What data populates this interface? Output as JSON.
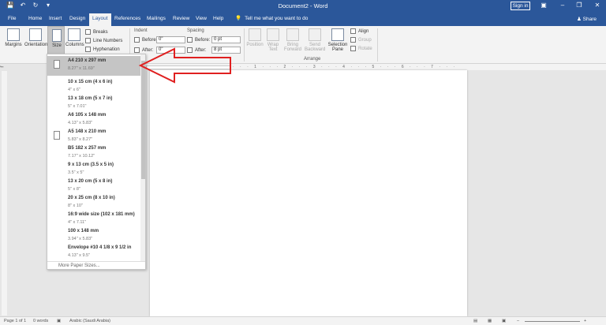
{
  "titlebar": {
    "title": "Document2  -  Word",
    "signin": "Sign in",
    "qat": [
      "save-icon",
      "undo-icon",
      "redo-icon",
      "customize-icon"
    ]
  },
  "tabs": [
    "File",
    "Home",
    "Insert",
    "Design",
    "Layout",
    "References",
    "Mailings",
    "Review",
    "View",
    "Help"
  ],
  "active_tab": "Layout",
  "tellme": "Tell me what you want to do",
  "share": "Share",
  "ribbon": {
    "margins": "Margins",
    "orientation": "Orientation",
    "size": "Size",
    "columns": "Columns",
    "breaks": "Breaks",
    "line_numbers": "Line Numbers",
    "hyphenation": "Hyphenation",
    "indent_label": "Indent",
    "indent_before_label": "Before:",
    "indent_before_value": "0\"",
    "indent_after_label": "After:",
    "indent_after_value": "0\"",
    "spacing_label": "Spacing",
    "spacing_before_label": "Before:",
    "spacing_before_value": "0 pt",
    "spacing_after_label": "After:",
    "spacing_after_value": "8 pt",
    "position": "Position",
    "wrap_text": "Wrap Text",
    "bring_forward": "Bring Forward",
    "send_backward": "Send Backward",
    "selection_pane": "Selection Pane",
    "align": "Align",
    "group": "Group",
    "rotate": "Rotate",
    "arrange_label": "Arrange"
  },
  "paper_sizes": [
    {
      "name": "A4 210 x 297 mm",
      "dims": "8.27\" x 11.69\"",
      "selected": true
    },
    {
      "name": "10 x 15 cm (4 x 6 in)",
      "dims": "4\" x 6\""
    },
    {
      "name": "13 x 18 cm (5 x 7 in)",
      "dims": "5\" x 7.01\""
    },
    {
      "name": "A6 105 x 148 mm",
      "dims": "4.13\" x 5.83\""
    },
    {
      "name": "A5 148 x 210 mm",
      "dims": "5.83\" x 8.27\""
    },
    {
      "name": "B5 182 x 257 mm",
      "dims": "7.17\" x 10.12\""
    },
    {
      "name": "9 x 13 cm (3.5 x 5 in)",
      "dims": "3.5\" x 5\""
    },
    {
      "name": "13 x 20 cm (5 x 8 in)",
      "dims": "5\" x 8\""
    },
    {
      "name": "20 x 25 cm (8 x 10 in)",
      "dims": "8\" x 10\""
    },
    {
      "name": "16:9 wide size (102 x 181 mm)",
      "dims": "4\" x 7.11\""
    },
    {
      "name": "100 x 148 mm",
      "dims": "3.94\" x 5.83\""
    },
    {
      "name": "Envelope #10 4 1/8 x 9 1/2 in",
      "dims": "4.13\" x 9.5\""
    }
  ],
  "more_paper_sizes": "More Paper Sizes...",
  "statusbar": {
    "page": "Page 1 of 1",
    "words": "0 words",
    "language": "Arabic (Saudi Arabia)"
  },
  "colors": {
    "accent": "#2b579a",
    "arrow": "#e02020"
  }
}
